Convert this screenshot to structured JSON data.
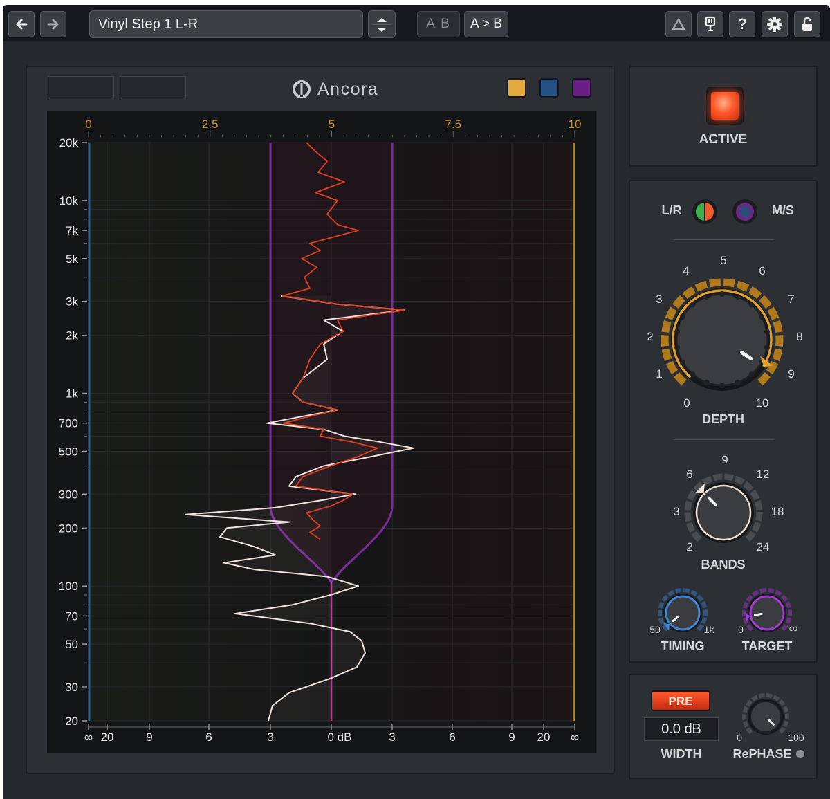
{
  "toolbar": {
    "back_icon": "arrow-left-icon",
    "forward_icon": "arrow-right-icon",
    "preset_name": "Vinyl Step 1 L-R",
    "ab_label": "A B",
    "atob_label": "A > B",
    "right_icons": [
      "delta-icon",
      "tuning-fork-icon",
      "help-icon",
      "gear-icon",
      "unlock-icon"
    ],
    "help_label": "?"
  },
  "header": {
    "logo_text": "Ancora",
    "swatches": [
      "#e2a93b",
      "#245083",
      "#6a1f86"
    ]
  },
  "graph": {
    "top_scale": [
      "0",
      "2.5",
      "5",
      "7.5",
      "10"
    ],
    "freq_labels": [
      "20k",
      "10k",
      "7k",
      "5k",
      "3k",
      "2k",
      "1k",
      "700",
      "500",
      "300",
      "200",
      "100",
      "70",
      "50",
      "30",
      "20"
    ],
    "bottom_scale": [
      "∞",
      "20",
      "9",
      "6",
      "3",
      "0 dB",
      "3",
      "6",
      "9",
      "20",
      "∞"
    ],
    "colors": {
      "left_rail": "#2a5d8c",
      "right_rail": "#a8802a",
      "depth_curve": "#7a2c9e",
      "center_line": "#c0409a",
      "white_trace": "#f0e4dc",
      "red_trace": "#e0401e"
    }
  },
  "active": {
    "label": "ACTIVE"
  },
  "mode": {
    "lr_label": "L/R",
    "ms_label": "M/S"
  },
  "depth": {
    "label": "DEPTH",
    "ticks": [
      "0",
      "1",
      "2",
      "3",
      "4",
      "5",
      "6",
      "7",
      "8",
      "9",
      "10"
    ],
    "value": 9.4
  },
  "bands": {
    "label": "BANDS",
    "ticks": [
      "2",
      "3",
      "6",
      "9",
      "12",
      "18",
      "24"
    ],
    "value": 6
  },
  "timing": {
    "label": "TIMING",
    "min": "50",
    "max": "1k"
  },
  "target": {
    "label": "TARGET",
    "min": "0",
    "max": "∞"
  },
  "width": {
    "pre_label": "PRE",
    "value": "0.0 dB",
    "label": "WIDTH"
  },
  "rephase": {
    "label": "RePHASE",
    "min": "0",
    "max": "100"
  }
}
